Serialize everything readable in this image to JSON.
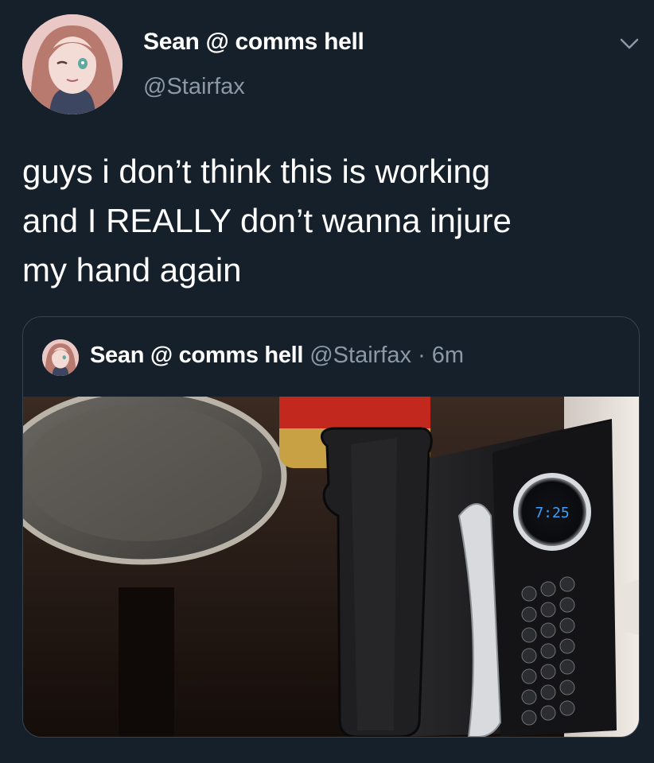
{
  "tweet": {
    "display_name": "Sean @ comms hell",
    "handle": "@Stairfax",
    "text_lines": [
      "guys i don’t think this is working",
      "and I REALLY don’t wanna injure",
      "my hand again"
    ]
  },
  "quoted": {
    "display_name": "Sean @ comms hell",
    "handle": "@Stairfax",
    "separator": "·",
    "time": "6m",
    "photo": {
      "microwave_display": "7:25"
    }
  },
  "icons": {
    "menu": "chevron-down-icon"
  },
  "colors": {
    "background": "#16202b",
    "secondary_text": "#8b98a5",
    "border": "#38444d",
    "microwave_display": "#3aa0ff"
  }
}
